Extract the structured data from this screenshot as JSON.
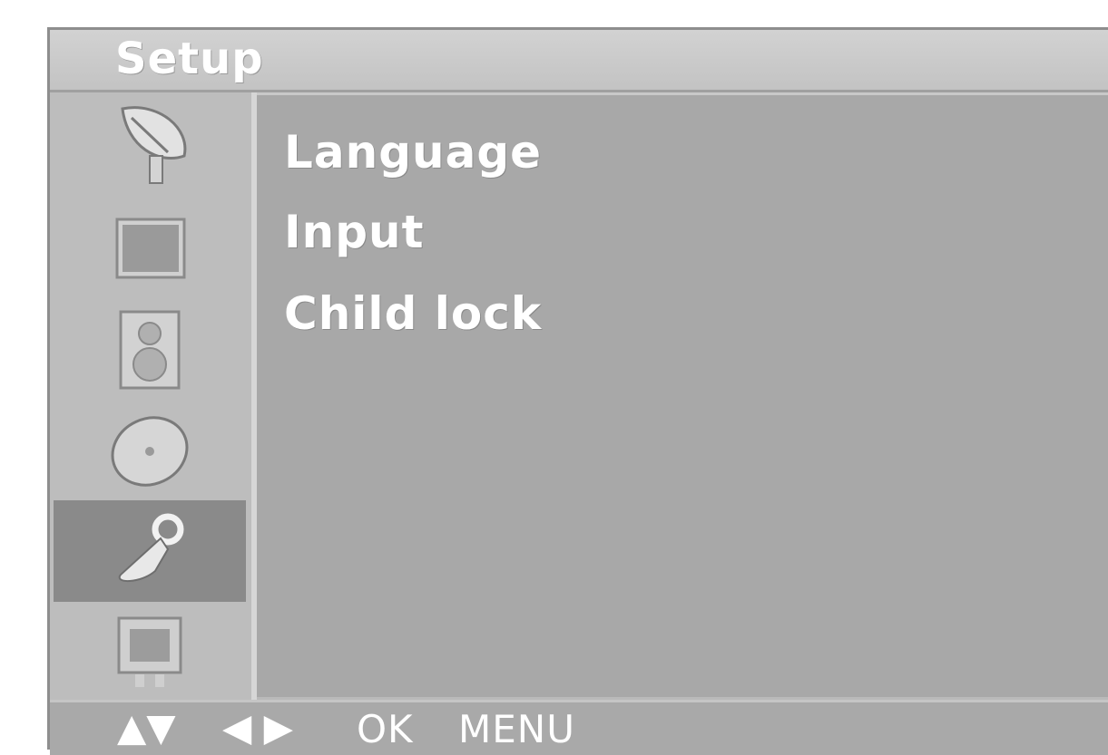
{
  "title": "Setup",
  "sidebar": {
    "items": [
      {
        "icon": "satellite-dish-icon"
      },
      {
        "icon": "picture-icon"
      },
      {
        "icon": "speaker-icon"
      },
      {
        "icon": "clock-icon"
      },
      {
        "icon": "wrench-icon",
        "selected": true
      },
      {
        "icon": "tv-icon"
      }
    ]
  },
  "menu": {
    "items": [
      {
        "label": "Language"
      },
      {
        "label": "Input"
      },
      {
        "label": "Child lock"
      }
    ]
  },
  "footer": {
    "up_down": "▲▼",
    "left_right": "◀ ▶",
    "ok": "OK",
    "menu": "MENU"
  },
  "colors": {
    "selected_item": "#8a8a8a",
    "panel": "#a8a8a8",
    "sidebar": "#bdbdbd"
  }
}
